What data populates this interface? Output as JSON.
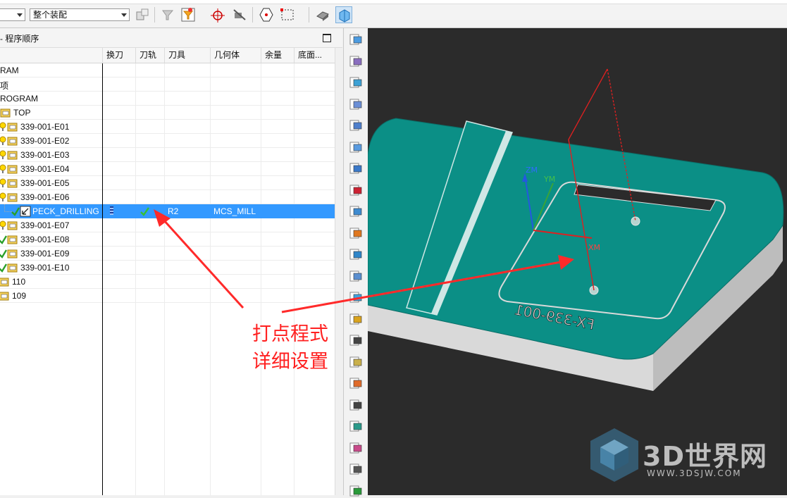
{
  "toolbar": {
    "combo1_value": "",
    "combo2_value": "整个装配",
    "icons": [
      "assembly-icon",
      "select-filter-icon",
      "filter-icon",
      "snap-point-icon",
      "view-icon",
      "point-icon",
      "selection-box-icon",
      "shade-icon",
      "render-mode-icon"
    ]
  },
  "navigator": {
    "title": "- 程序顺序",
    "columns": [
      "换刀",
      "刀轨",
      "刀具",
      "几何体",
      "余量",
      "底面..."
    ],
    "rows": [
      {
        "name": "RAM",
        "indent": 0,
        "icon": "none"
      },
      {
        "name": "项",
        "indent": 0,
        "icon": "none"
      },
      {
        "name": "ROGRAM",
        "indent": 0,
        "icon": "none"
      },
      {
        "name": "TOP",
        "indent": 0,
        "icon": "folder"
      },
      {
        "name": "339-001-E01",
        "indent": 1,
        "icon": "folder",
        "status": "warn"
      },
      {
        "name": "339-001-E02",
        "indent": 1,
        "icon": "folder",
        "status": "warn"
      },
      {
        "name": "339-001-E03",
        "indent": 1,
        "icon": "folder",
        "status": "warn"
      },
      {
        "name": "339-001-E04",
        "indent": 1,
        "icon": "folder",
        "status": "warn"
      },
      {
        "name": "339-001-E05",
        "indent": 1,
        "icon": "folder",
        "status": "warn"
      },
      {
        "name": "339-001-E06",
        "indent": 1,
        "icon": "folder",
        "status": "warn"
      },
      {
        "name": "PECK_DRILLING",
        "indent": 2,
        "icon": "drill",
        "status": "ok",
        "selected": true,
        "tool": "R2",
        "geometry": "MCS_MILL"
      },
      {
        "name": "339-001-E07",
        "indent": 1,
        "icon": "folder",
        "status": "warn"
      },
      {
        "name": "339-001-E08",
        "indent": 1,
        "icon": "folder",
        "status": "ok"
      },
      {
        "name": "339-001-E09",
        "indent": 1,
        "icon": "folder",
        "status": "ok"
      },
      {
        "name": "339-001-E10",
        "indent": 1,
        "icon": "folder",
        "status": "ok"
      },
      {
        "name": "110",
        "indent": 1,
        "icon": "folder"
      },
      {
        "name": "109",
        "indent": 1,
        "icon": "folder"
      }
    ]
  },
  "right_toolbar_icons": [
    "create-program-icon",
    "create-tool-icon",
    "create-geometry-icon",
    "create-method-icon",
    "create-operation-icon",
    "copy-icon",
    "tool-path-icon",
    "verify-icon",
    "edit-icon",
    "postprocess-icon",
    "ship-icon",
    "shop-doc-icon",
    "grid-icon",
    "clipboard-icon",
    "text-icon",
    "pencil-icon",
    "paste-icon",
    "page-icon",
    "mold-icon",
    "list-icon",
    "printer-icon",
    "refresh-icon"
  ],
  "viewport": {
    "axis_zm": "ZM",
    "axis_ym": "YM",
    "axis_xm": "XM",
    "engraving": "FX-339-001",
    "colors": {
      "part_top": "#0b8f86",
      "part_side": "#d8d8d8",
      "background": "#2b2b2b",
      "path": "#e02020"
    }
  },
  "annotation": {
    "line1": "打点程式",
    "line2": "详细设置",
    "color": "#ff2020"
  },
  "watermark": {
    "text": "3D世界网",
    "sub": "WWW.3DSJW.COM"
  }
}
